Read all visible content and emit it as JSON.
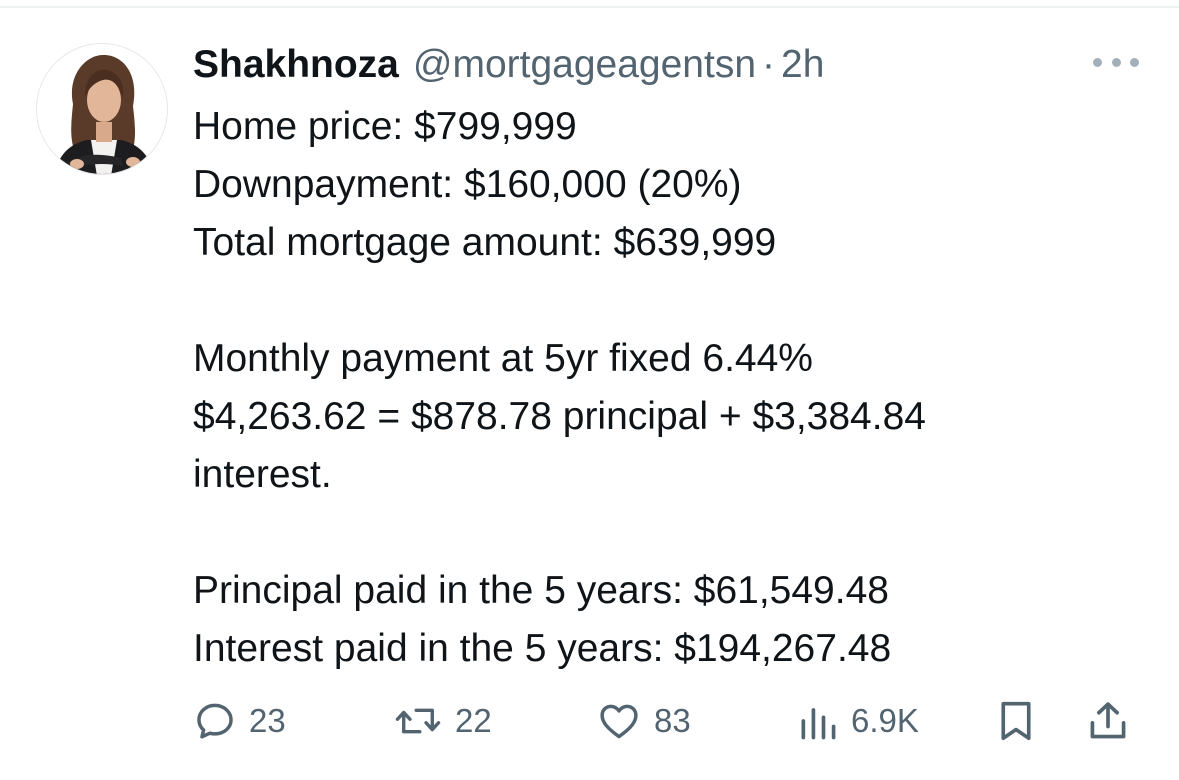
{
  "tweet": {
    "author": {
      "display_name": "Shakhnoza",
      "handle": "@mortgageagentsn",
      "separator": "·",
      "time": "2h"
    },
    "avatar_icon": "profile-photo",
    "more_icon": "ellipsis-icon",
    "lines": [
      "Home price: $799,999",
      "Downpayment: $160,000 (20%)",
      "Total mortgage amount: $639,999",
      "Monthly payment at 5yr fixed 6.44%",
      "$4,263.62 = $878.78 principal + $3,384.84",
      "interest.",
      "Principal paid in the 5 years: $61,549.48",
      "Interest paid in the 5 years: $194,267.48"
    ],
    "actions": {
      "reply": {
        "icon": "reply-icon",
        "count": "23"
      },
      "retweet": {
        "icon": "retweet-icon",
        "count": "22"
      },
      "like": {
        "icon": "heart-icon",
        "count": "83"
      },
      "views": {
        "icon": "views-chart-icon",
        "count": "6.9K"
      },
      "bookmark": {
        "icon": "bookmark-icon"
      },
      "share": {
        "icon": "share-icon"
      }
    },
    "colors": {
      "text": "#0f1419",
      "secondary": "#536471",
      "divider": "#eff3f4"
    }
  }
}
